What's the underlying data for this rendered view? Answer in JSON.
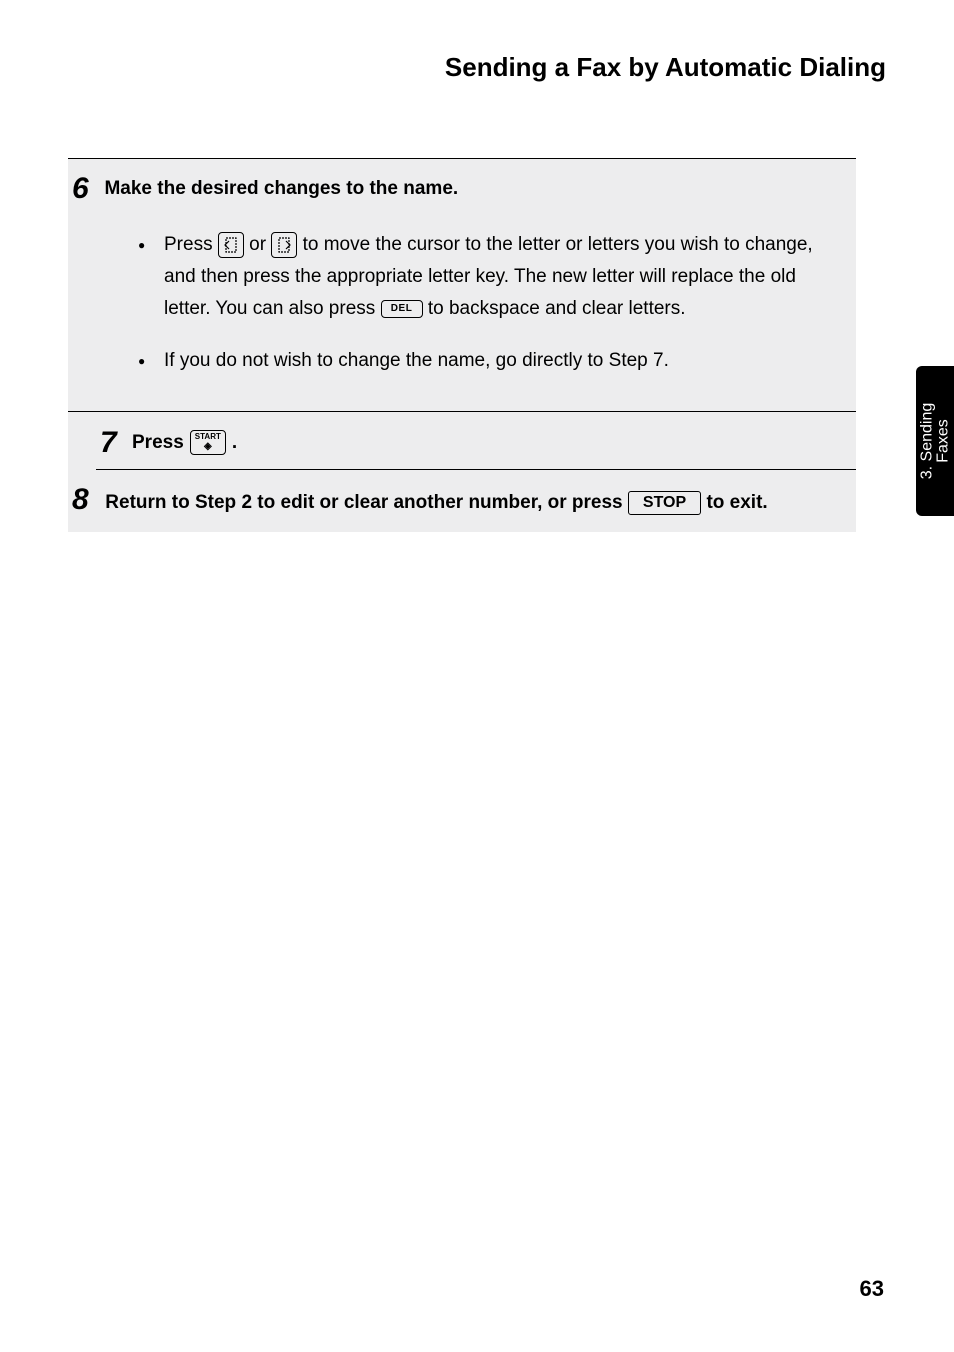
{
  "title": "Sending a Fax by Automatic Dialing",
  "tab": {
    "line1": "3. Sending",
    "line2": "Faxes"
  },
  "steps": {
    "s6": {
      "num": "6",
      "title": "Make the desired changes to the name.",
      "bullet1_a": "Press ",
      "bullet1_b": " or ",
      "bullet1_c": " to move the cursor to the letter or letters you wish to change, and then press the appropriate letter key. The new letter will replace the old letter. You can also press ",
      "bullet1_d": " to backspace and clear letters.",
      "del_label": "DEL",
      "bullet2": "If you do not wish to change the name, go directly to Step 7."
    },
    "s7": {
      "num": "7",
      "title_a": "Press ",
      "title_b": ".",
      "start_label": "START"
    },
    "s8": {
      "num": "8",
      "title_a": "Return to Step 2 to edit or clear another number, or press ",
      "title_b": " to exit.",
      "stop_label": "STOP"
    }
  },
  "pageNumber": "63"
}
